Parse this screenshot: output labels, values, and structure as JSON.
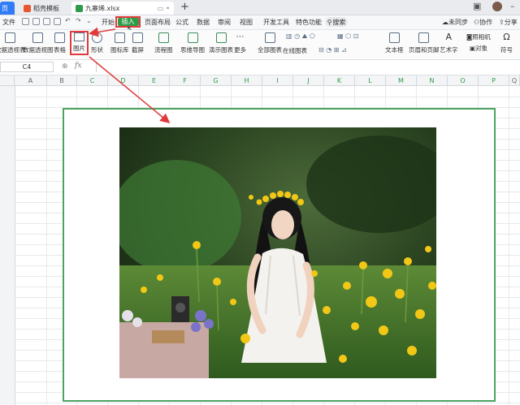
{
  "tabs": {
    "home": "页",
    "template": "稻壳模板",
    "file": "九寨烯.xlsx",
    "add": "+"
  },
  "menu": {
    "file": "文件",
    "start": "开始",
    "insert": "插入",
    "page_layout": "页面布局",
    "formula": "公式",
    "data": "数据",
    "review": "审阅",
    "view": "视图",
    "developer": "开发工具",
    "special": "特色功能",
    "search": "搜索",
    "unsynced": "未同步",
    "collab": "协作",
    "share": "分享"
  },
  "ribbon": {
    "pivot_table": "数据透视表",
    "pivot_chart": "数据透视图",
    "table": "表格",
    "picture": "图片",
    "shape": "形状",
    "icon_lib": "图标库",
    "screenshot": "截屏",
    "flowchart": "流程图",
    "mindmap": "思维导图",
    "demo_chart": "演示图表",
    "more": "更多",
    "all_charts": "全部图表",
    "online_charts": "在线图表",
    "textbox": "文本框",
    "header_footer": "页眉和页脚",
    "wordart": "艺术字",
    "camera": "照相机",
    "object": "对象",
    "symbol": "符号"
  },
  "formula_bar": {
    "cell_ref": "C4",
    "fx": "fx"
  },
  "columns": [
    "A",
    "B",
    "C",
    "D",
    "E",
    "F",
    "G",
    "H",
    "I",
    "J",
    "K",
    "L",
    "M",
    "N",
    "O",
    "P",
    "Q"
  ],
  "colors": {
    "accent_green": "#2e9c4a",
    "annotation_red": "#e03a3a",
    "frame_green": "#4aa35e"
  }
}
